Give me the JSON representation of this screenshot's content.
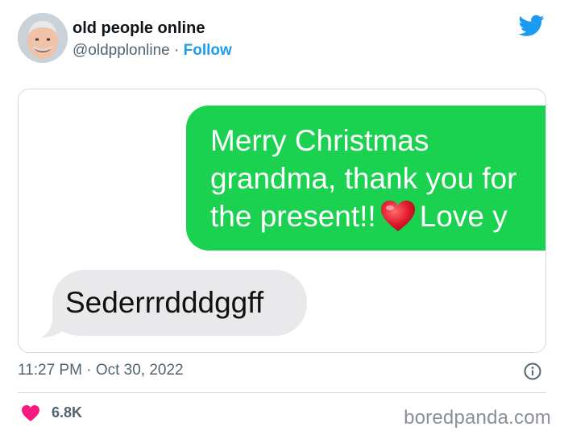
{
  "author": {
    "name": "old people online",
    "handle": "@oldpplonline",
    "separator": "·",
    "follow_label": "Follow"
  },
  "icons": {
    "brand": "twitter-bird-icon",
    "info": "info-icon",
    "like": "heart-icon",
    "emoji": "red-heart-emoji"
  },
  "media": {
    "sent_message": {
      "line1": "Merry Christmas",
      "line2": "grandma, thank you for",
      "line3a": "the present!!",
      "line3b": "Love y"
    },
    "received_message": "Sederrrdddggff"
  },
  "meta": {
    "time": "11:27 PM",
    "dot": "·",
    "date": "Oct 30, 2022"
  },
  "engagement": {
    "likes": "6.8K"
  },
  "watermark": "boredpanda.com",
  "colors": {
    "twitter_blue": "#1d9bf0",
    "imessage_green": "#1ad150",
    "bubble_gray": "#e9e9eb",
    "like_pink": "#f91880",
    "muted_text": "#536471"
  }
}
